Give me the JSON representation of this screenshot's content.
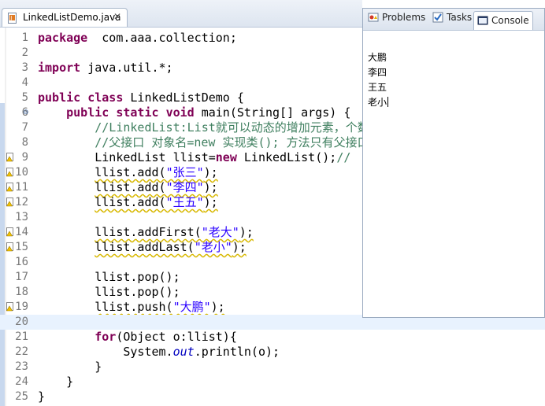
{
  "editor": {
    "tab_title": "LinkedListDemo.java",
    "close_glyph": "✕"
  },
  "code": {
    "lines": [
      {
        "n": "1",
        "tokens": [
          [
            "kw",
            "package"
          ],
          [
            "",
            "  com.aaa.collection;"
          ]
        ]
      },
      {
        "n": "2",
        "tokens": []
      },
      {
        "n": "3",
        "tokens": [
          [
            "kw",
            "import"
          ],
          [
            "",
            " java.util.*;"
          ]
        ]
      },
      {
        "n": "4",
        "tokens": []
      },
      {
        "n": "5",
        "tokens": [
          [
            "kw",
            "public"
          ],
          [
            "",
            " "
          ],
          [
            "kw",
            "class"
          ],
          [
            "",
            " LinkedListDemo {"
          ]
        ]
      },
      {
        "n": "6",
        "fold": true,
        "tokens": [
          [
            "",
            "    "
          ],
          [
            "kw",
            "public"
          ],
          [
            "",
            " "
          ],
          [
            "kw",
            "static"
          ],
          [
            "",
            " "
          ],
          [
            "kw",
            "void"
          ],
          [
            "",
            " main(String[] args) {"
          ]
        ]
      },
      {
        "n": "7",
        "tokens": [
          [
            "",
            "        "
          ],
          [
            "cm",
            "//LinkedList:List就可以动态的增加元素，个数不固定"
          ]
        ]
      },
      {
        "n": "8",
        "tokens": [
          [
            "",
            "        "
          ],
          [
            "cm",
            "//父接口 对象名=new 实现类(); 方法只有父接口中的方法"
          ]
        ]
      },
      {
        "n": "9",
        "warn": true,
        "tokens": [
          [
            "",
            "        LinkedList llist="
          ],
          [
            "kw",
            "new"
          ],
          [
            "",
            " LinkedList();"
          ],
          [
            "cm",
            "//"
          ]
        ]
      },
      {
        "n": "10",
        "warn": true,
        "tokens": [
          [
            "",
            "        "
          ],
          [
            "squig",
            "llist.add("
          ],
          [
            "str squig",
            "\"张三\""
          ],
          [
            "squig",
            ");"
          ]
        ]
      },
      {
        "n": "11",
        "warn": true,
        "tokens": [
          [
            "",
            "        "
          ],
          [
            "squig",
            "llist.add("
          ],
          [
            "str squig",
            "\"李四\""
          ],
          [
            "squig",
            ");"
          ]
        ]
      },
      {
        "n": "12",
        "warn": true,
        "tokens": [
          [
            "",
            "        "
          ],
          [
            "squig",
            "llist.add("
          ],
          [
            "str squig",
            "\"王五\""
          ],
          [
            "squig",
            ");"
          ]
        ]
      },
      {
        "n": "13",
        "tokens": []
      },
      {
        "n": "14",
        "warn": true,
        "tokens": [
          [
            "",
            "        "
          ],
          [
            "squig",
            "llist.addFirst("
          ],
          [
            "str squig",
            "\"老大\""
          ],
          [
            "squig",
            ");"
          ]
        ]
      },
      {
        "n": "15",
        "warn": true,
        "tokens": [
          [
            "",
            "        "
          ],
          [
            "squig",
            "llist.addLast("
          ],
          [
            "str squig",
            "\"老小\""
          ],
          [
            "squig",
            ");"
          ]
        ]
      },
      {
        "n": "16",
        "tokens": []
      },
      {
        "n": "17",
        "tokens": [
          [
            "",
            "        llist.pop();"
          ]
        ]
      },
      {
        "n": "18",
        "tokens": [
          [
            "",
            "        llist.pop();"
          ]
        ]
      },
      {
        "n": "19",
        "warn": true,
        "tokens": [
          [
            "",
            "        "
          ],
          [
            "squig",
            "llist.push("
          ],
          [
            "str squig",
            "\"大鹏\""
          ],
          [
            "squig",
            ");"
          ]
        ]
      },
      {
        "n": "20",
        "current": true,
        "tokens": []
      },
      {
        "n": "21",
        "tokens": [
          [
            "",
            "        "
          ],
          [
            "kw",
            "for"
          ],
          [
            "",
            "(Object o:llist){"
          ]
        ]
      },
      {
        "n": "22",
        "tokens": [
          [
            "",
            "            System."
          ],
          [
            "fld",
            "out"
          ],
          [
            "",
            ".println(o);"
          ]
        ]
      },
      {
        "n": "23",
        "tokens": [
          [
            "",
            "        }"
          ]
        ]
      },
      {
        "n": "24",
        "tokens": [
          [
            "",
            "    }"
          ]
        ]
      },
      {
        "n": "25",
        "tokens": [
          [
            "",
            "}"
          ]
        ]
      }
    ]
  },
  "views": {
    "problems_label": "Problems",
    "tasks_label": "Tasks",
    "console_label": "Console"
  },
  "console": {
    "output": [
      "大鹏",
      "李四",
      "王五",
      "老小"
    ]
  },
  "colors": {
    "keyword": "#7f0055",
    "comment": "#3f7f5f",
    "string": "#2a00ff",
    "current_line": "#e8f2fe"
  },
  "icons": {
    "java_file": "java-file-icon",
    "warning": "warning-icon",
    "problems": "problems-icon",
    "tasks": "tasks-icon",
    "console": "console-icon"
  }
}
